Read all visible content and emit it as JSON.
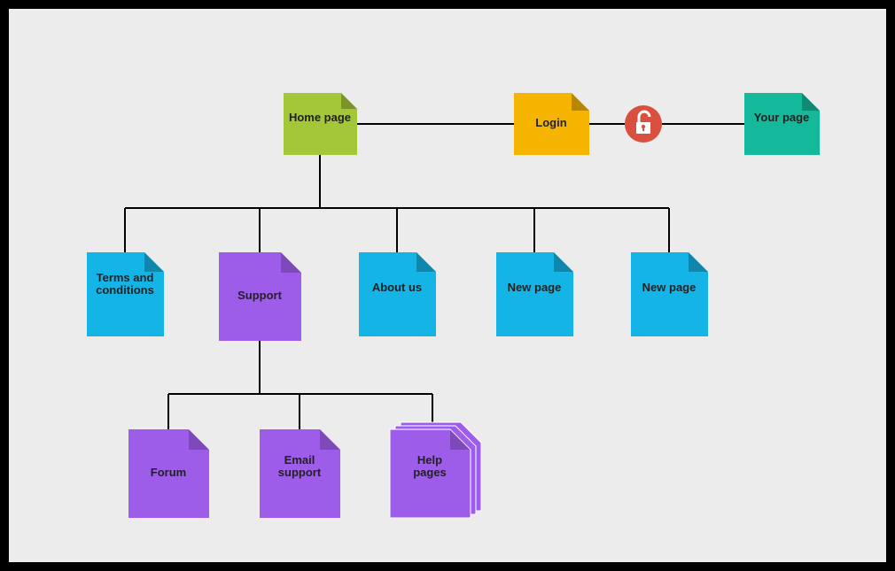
{
  "sitemap": {
    "root": {
      "label": "Home page",
      "color": "#a4c639"
    },
    "login": {
      "label": "Login",
      "color": "#f4b400"
    },
    "yourpage": {
      "label": "Your page",
      "color": "#14b89a"
    },
    "lock_icon_color": "#d9503f",
    "children": [
      {
        "label": "Terms and conditions",
        "color": "#15b4e6"
      },
      {
        "label": "Support",
        "color": "#9e5de8"
      },
      {
        "label": "About us",
        "color": "#15b4e6"
      },
      {
        "label": "New page",
        "color": "#15b4e6"
      },
      {
        "label": "New page",
        "color": "#15b4e6"
      }
    ],
    "support_children": [
      {
        "label": "Forum",
        "color": "#9e5de8"
      },
      {
        "label": "Email support",
        "color": "#9e5de8"
      },
      {
        "label": "Help pages",
        "color": "#9e5de8",
        "stacked": true
      }
    ]
  }
}
